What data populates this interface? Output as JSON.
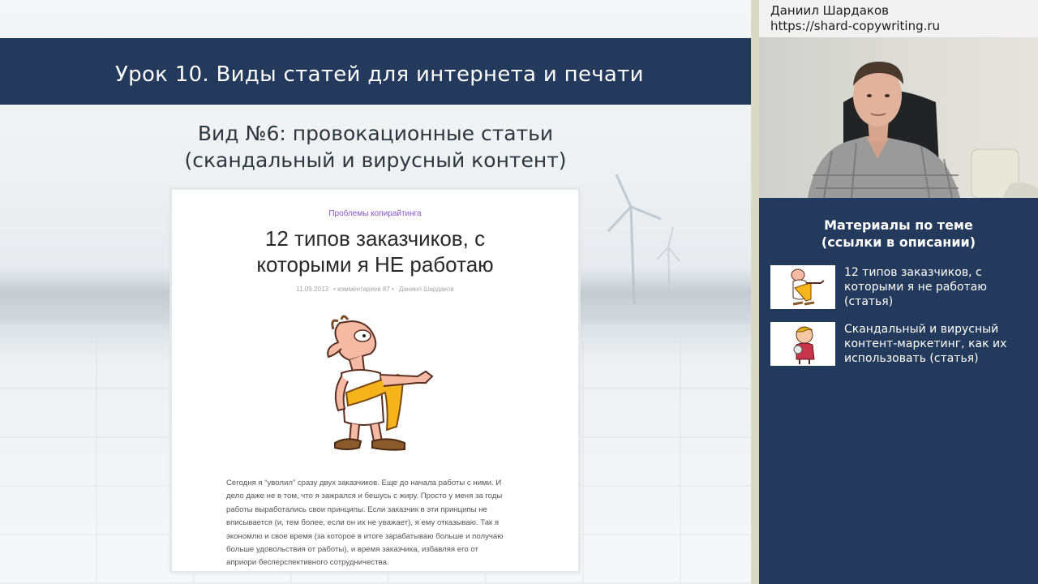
{
  "slide": {
    "lesson_title": "Урок 10. Виды статей для интернета и печати",
    "section_title_line1": "Вид №6: провокационные статьи",
    "section_title_line2": "(скандальный и вирусный контент)"
  },
  "article": {
    "category": "Проблемы копирайтинга",
    "title_line1": "12 типов заказчиков, с",
    "title_line2": "которыми я НЕ работаю",
    "date": "11.09.2013",
    "comments": "• комментариев 87 •",
    "author": "Даниил Шардаков",
    "body_lines": [
      "Сегодня я “уволил” сразу двух заказчиков. Еще до начала работы с ними. И",
      "дело даже не в том, что я зажрался и бешусь с жиру. Просто у меня за годы",
      "работы выработались свои принципы. Если заказчик в эти принципы не",
      "вписывается (и, тем более, если он их не уважает), я ему отказываю. Так я",
      "экономлю и свое время (за которое в итоге зарабатываю больше и получаю",
      "больше удовольствия от работы), и время заказчика, избавляя его от",
      "априори бесперспективного сотрудничества."
    ]
  },
  "sidebar": {
    "author_name": "Даниил Шардаков",
    "author_url": "https://shard-copywriting.ru",
    "materials_title_line1": "Материалы по теме",
    "materials_title_line2": "(ссылки в описании)",
    "materials": [
      {
        "lines": [
          "12 типов заказчиков, с",
          "которыми я не работаю",
          "(статья)"
        ]
      },
      {
        "lines": [
          "Скандальный и вирусный",
          "контент-маркетинг, как их",
          "использовать (статья)"
        ]
      }
    ]
  },
  "colors": {
    "title_band": "#233a5c",
    "sidebar_bg": "#233a5c",
    "category_text": "#8a55c8"
  }
}
